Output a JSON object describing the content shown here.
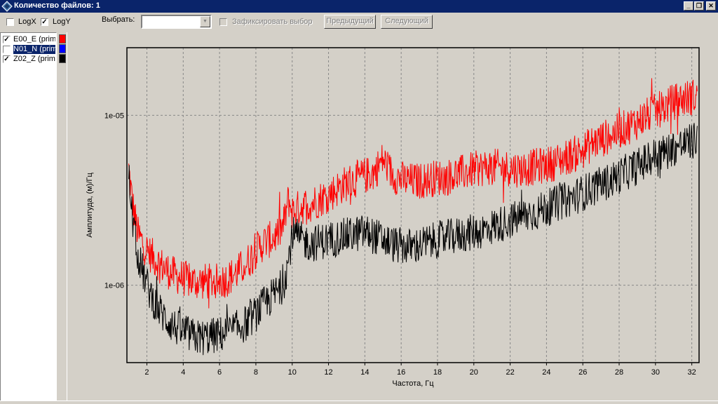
{
  "window": {
    "title": "Количество файлов: 1",
    "buttons": [
      "_",
      "❐",
      "✕"
    ]
  },
  "toolbar": {
    "logx": {
      "label": "LogX",
      "checked": false
    },
    "logy": {
      "label": "LogY",
      "checked": true
    },
    "select_label": "Выбрать:",
    "select_value": "",
    "fix_selection": {
      "label": "Зафиксировать выбор",
      "checked": false
    },
    "prev_label": "Предыдущий",
    "next_label": "Следующий"
  },
  "files": [
    {
      "name": "E00_E (prim",
      "checked": true,
      "color": "#ff0000",
      "selected": false
    },
    {
      "name": "N01_N (prim",
      "checked": false,
      "color": "#0000ff",
      "selected": true
    },
    {
      "name": "Z02_Z (prim",
      "checked": true,
      "color": "#000000",
      "selected": false
    }
  ],
  "chart_data": {
    "type": "line",
    "xlabel": "Частота, Гц",
    "ylabel": "Амплитуда, (м)/Гц",
    "xlim": [
      0.9,
      32.4
    ],
    "ylim": [
      3.5e-07,
      2.5e-05
    ],
    "yscale": "log",
    "grid": true,
    "xticks": [
      2,
      4,
      6,
      8,
      10,
      12,
      14,
      16,
      18,
      20,
      22,
      24,
      26,
      28,
      30,
      32
    ],
    "xtick_labels": [
      "2",
      "4",
      "6",
      "8",
      "10",
      "12",
      "14",
      "16",
      "18",
      "20",
      "22",
      "24",
      "26",
      "28",
      "30",
      "32"
    ],
    "yticks": [
      1e-06,
      1e-05
    ],
    "ytick_labels": [
      "1e-06",
      "1e-05"
    ],
    "series": [
      {
        "color": "#ff0000",
        "x": [
          1.0,
          1.2,
          1.5,
          2.0,
          2.5,
          3.0,
          3.5,
          4.0,
          4.5,
          5.0,
          5.5,
          6.0,
          6.5,
          7.0,
          7.5,
          8.0,
          8.5,
          9.0,
          9.5,
          9.8,
          10.0,
          10.5,
          11.0,
          11.5,
          12.0,
          12.5,
          13.0,
          13.5,
          14.0,
          14.5,
          15.0,
          15.5,
          16.0,
          16.5,
          17.0,
          17.5,
          18.0,
          18.5,
          19.0,
          19.5,
          20.0,
          20.5,
          21.0,
          21.5,
          22.0,
          22.5,
          23.0,
          23.5,
          24.0,
          24.5,
          25.0,
          25.5,
          26.0,
          26.5,
          27.0,
          27.5,
          28.0,
          28.5,
          29.0,
          29.5,
          30.0,
          30.5,
          31.0,
          31.5,
          32.0,
          32.3
        ],
        "y": [
          4.8e-06,
          3.1e-06,
          2e-06,
          1.6e-06,
          1.4e-06,
          1.25e-06,
          1.15e-06,
          1.1e-06,
          1.05e-06,
          1.05e-06,
          1.05e-06,
          1.05e-06,
          1.1e-06,
          1.2e-06,
          1.35e-06,
          1.6e-06,
          1.8e-06,
          1.9e-06,
          2.2e-06,
          3.2e-06,
          2.7e-06,
          2.9e-06,
          3e-06,
          3.2e-06,
          3.4e-06,
          3.7e-06,
          4e-06,
          4.2e-06,
          4.4e-06,
          4.6e-06,
          5.5e-06,
          4.5e-06,
          4.2e-06,
          4.1e-06,
          4.1e-06,
          4.2e-06,
          4.3e-06,
          4.3e-06,
          4.5e-06,
          4.6e-06,
          4.8e-06,
          4.9e-06,
          5e-06,
          4.9e-06,
          4.9e-06,
          4.8e-06,
          4.9e-06,
          5e-06,
          5.1e-06,
          5.3e-06,
          5.6e-06,
          5.9e-06,
          6.2e-06,
          6.8e-06,
          7.2e-06,
          7.6e-06,
          8.1e-06,
          8.6e-06,
          9.2e-06,
          9.9e-06,
          1.05e-05,
          1.12e-05,
          1.2e-05,
          1.25e-05,
          1.28e-05,
          1.3e-05
        ]
      },
      {
        "color": "#000000",
        "x": [
          1.0,
          1.2,
          1.5,
          2.0,
          2.5,
          3.0,
          3.5,
          4.0,
          4.5,
          5.0,
          5.5,
          6.0,
          6.5,
          7.0,
          7.5,
          8.0,
          8.5,
          9.0,
          9.5,
          9.8,
          10.0,
          10.5,
          11.0,
          11.5,
          12.0,
          12.5,
          13.0,
          13.5,
          14.0,
          14.5,
          15.0,
          15.5,
          16.0,
          16.5,
          17.0,
          17.5,
          18.0,
          18.5,
          19.0,
          19.5,
          20.0,
          20.5,
          21.0,
          21.5,
          22.0,
          22.5,
          23.0,
          23.5,
          24.0,
          24.5,
          25.0,
          25.5,
          26.0,
          26.5,
          27.0,
          27.5,
          28.0,
          28.5,
          29.0,
          29.5,
          30.0,
          30.5,
          31.0,
          31.5,
          32.0,
          32.3
        ],
        "y": [
          4.5e-06,
          2.5e-06,
          1.5e-06,
          1e-06,
          7.6e-07,
          6.4e-07,
          5.7e-07,
          5.3e-07,
          5e-07,
          4.9e-07,
          5e-07,
          5.1e-07,
          5.3e-07,
          5.6e-07,
          6e-07,
          6.8e-07,
          7.8e-07,
          8.8e-07,
          1e-06,
          1.4e-06,
          2e-06,
          1.85e-06,
          1.75e-06,
          1.8e-06,
          1.85e-06,
          1.9e-06,
          1.95e-06,
          2e-06,
          2.05e-06,
          1.95e-06,
          1.85e-06,
          1.75e-06,
          1.7e-06,
          1.68e-06,
          1.72e-06,
          1.78e-06,
          1.85e-06,
          1.9e-06,
          1.95e-06,
          2e-06,
          2.05e-06,
          2.1e-06,
          2.2e-06,
          2.3e-06,
          2.4e-06,
          2.5e-06,
          2.6e-06,
          2.7e-06,
          2.85e-06,
          3e-06,
          3.15e-06,
          3.3e-06,
          3.5e-06,
          3.7e-06,
          3.9e-06,
          4.1e-06,
          4.4e-06,
          4.7e-06,
          5e-06,
          5.4e-06,
          5.8e-06,
          6.1e-06,
          6.4e-06,
          6.7e-06,
          7e-06,
          7.2e-06
        ]
      }
    ]
  }
}
